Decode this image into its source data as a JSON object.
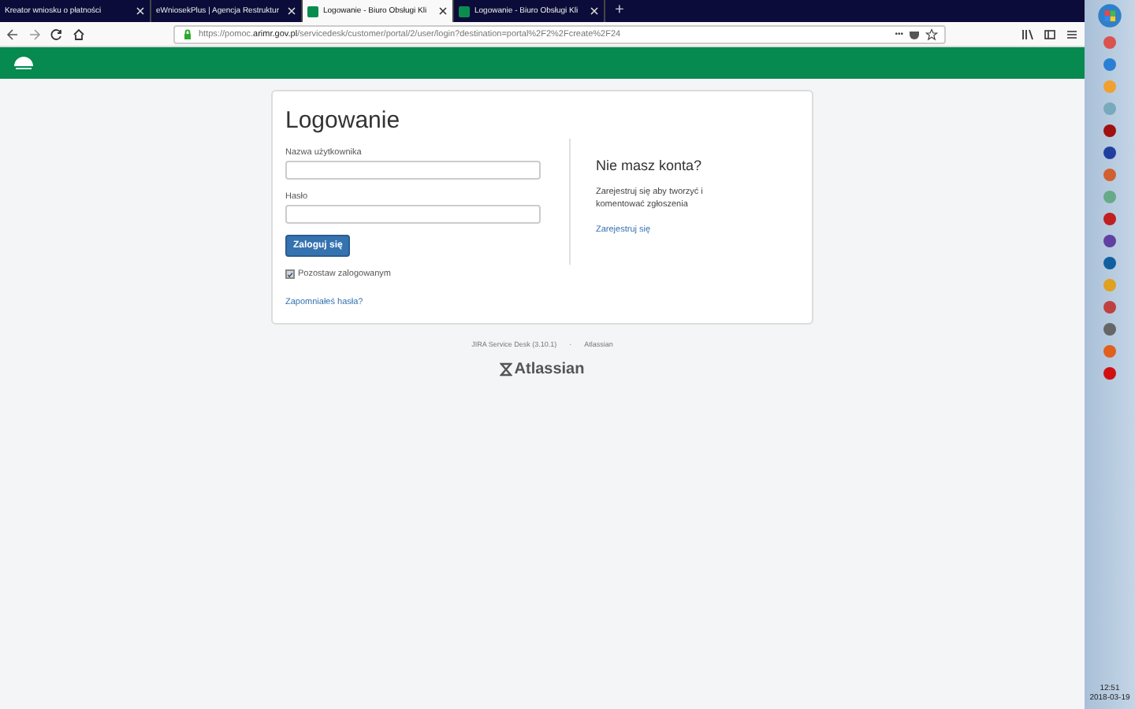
{
  "browser": {
    "tabs": [
      {
        "title": "Kreator wniosku o płatności",
        "selected": false,
        "icon": false
      },
      {
        "title": "eWniosekPlus | Agencja Restruktur",
        "selected": false,
        "icon": false
      },
      {
        "title": "Logowanie - Biuro Obsługi Kli",
        "selected": true,
        "icon": true
      },
      {
        "title": "Logowanie - Biuro Obsługi Kli",
        "selected": false,
        "icon": true
      }
    ],
    "new_tab": "+",
    "url": {
      "prefix": "https://pomoc.",
      "domain": "arimr.gov.pl",
      "path": "/servicedesk/customer/portal/2/user/login?destination=portal%2F2%2Fcreate%2F24"
    },
    "more": "•••"
  },
  "login": {
    "title": "Logowanie",
    "username_label": "Nazwa użytkownika",
    "password_label": "Hasło",
    "submit": "Zaloguj się",
    "remember": {
      "label": "Pozostaw zalogowanym",
      "checked": true
    },
    "forgot": "Zapomniałeś hasła?"
  },
  "signup": {
    "title": "Nie masz konta?",
    "text": "Zarejestruj się aby tworzyć i komentować zgłoszenia",
    "link": "Zarejestruj się"
  },
  "footer": {
    "product": "JIRA Service Desk (3.10.1)",
    "separator": "·",
    "vendor": "Atlassian",
    "logo": "Atlassian"
  },
  "taskbar": {
    "time": "12:51",
    "date": "2018-03-19"
  }
}
